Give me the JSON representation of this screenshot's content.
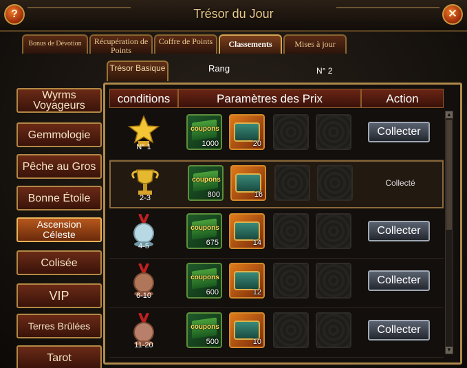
{
  "window": {
    "title": "Trésor du Jour"
  },
  "tabs": [
    {
      "label": "Bonus de Dévotion",
      "active": false
    },
    {
      "label": "Récupération de Points",
      "active": false
    },
    {
      "label": "Coffre de Points",
      "active": false
    },
    {
      "label": "Classements",
      "active": true
    },
    {
      "label": "Mises à jour",
      "active": false
    }
  ],
  "subtab": {
    "label": "Trésor Basique"
  },
  "rank": {
    "label": "Rang",
    "value": "N° 2"
  },
  "sidebar": {
    "items": [
      {
        "label": "Wyrms Voyageurs",
        "active": false
      },
      {
        "label": "Gemmologie",
        "active": false
      },
      {
        "label": "Pêche au Gros",
        "active": false
      },
      {
        "label": "Bonne Étoile",
        "active": false
      },
      {
        "label": "Ascension Céleste",
        "active": true
      },
      {
        "label": "Colisée",
        "active": false
      },
      {
        "label": "VIP",
        "active": false
      },
      {
        "label": "Terres Brûlées",
        "active": false
      },
      {
        "label": "Tarot",
        "active": false
      }
    ]
  },
  "table": {
    "headers": {
      "conditions": "conditions",
      "rewards": "Paramètres des Prix",
      "action": "Action"
    },
    "rows": [
      {
        "rank": "N° 1",
        "medal": "gold-star-trophy-icon",
        "coupons": "1000",
        "chests": "20",
        "action": "Collecter",
        "collected": false
      },
      {
        "rank": "2-3",
        "medal": "gold-cup-trophy-icon",
        "coupons": "800",
        "chests": "16",
        "action": "Collecté",
        "collected": true
      },
      {
        "rank": "4-5",
        "medal": "silver-medal-icon",
        "coupons": "675",
        "chests": "14",
        "action": "Collecter",
        "collected": false
      },
      {
        "rank": "6-10",
        "medal": "bronze-medal-icon",
        "coupons": "600",
        "chests": "12",
        "action": "Collecter",
        "collected": false
      },
      {
        "rank": "11-20",
        "medal": "bronze-medal-icon",
        "coupons": "500",
        "chests": "10",
        "action": "Collecter",
        "collected": false
      }
    ],
    "coupon_label": "coupons"
  },
  "icons": {
    "help": "?",
    "close": "✕"
  }
}
